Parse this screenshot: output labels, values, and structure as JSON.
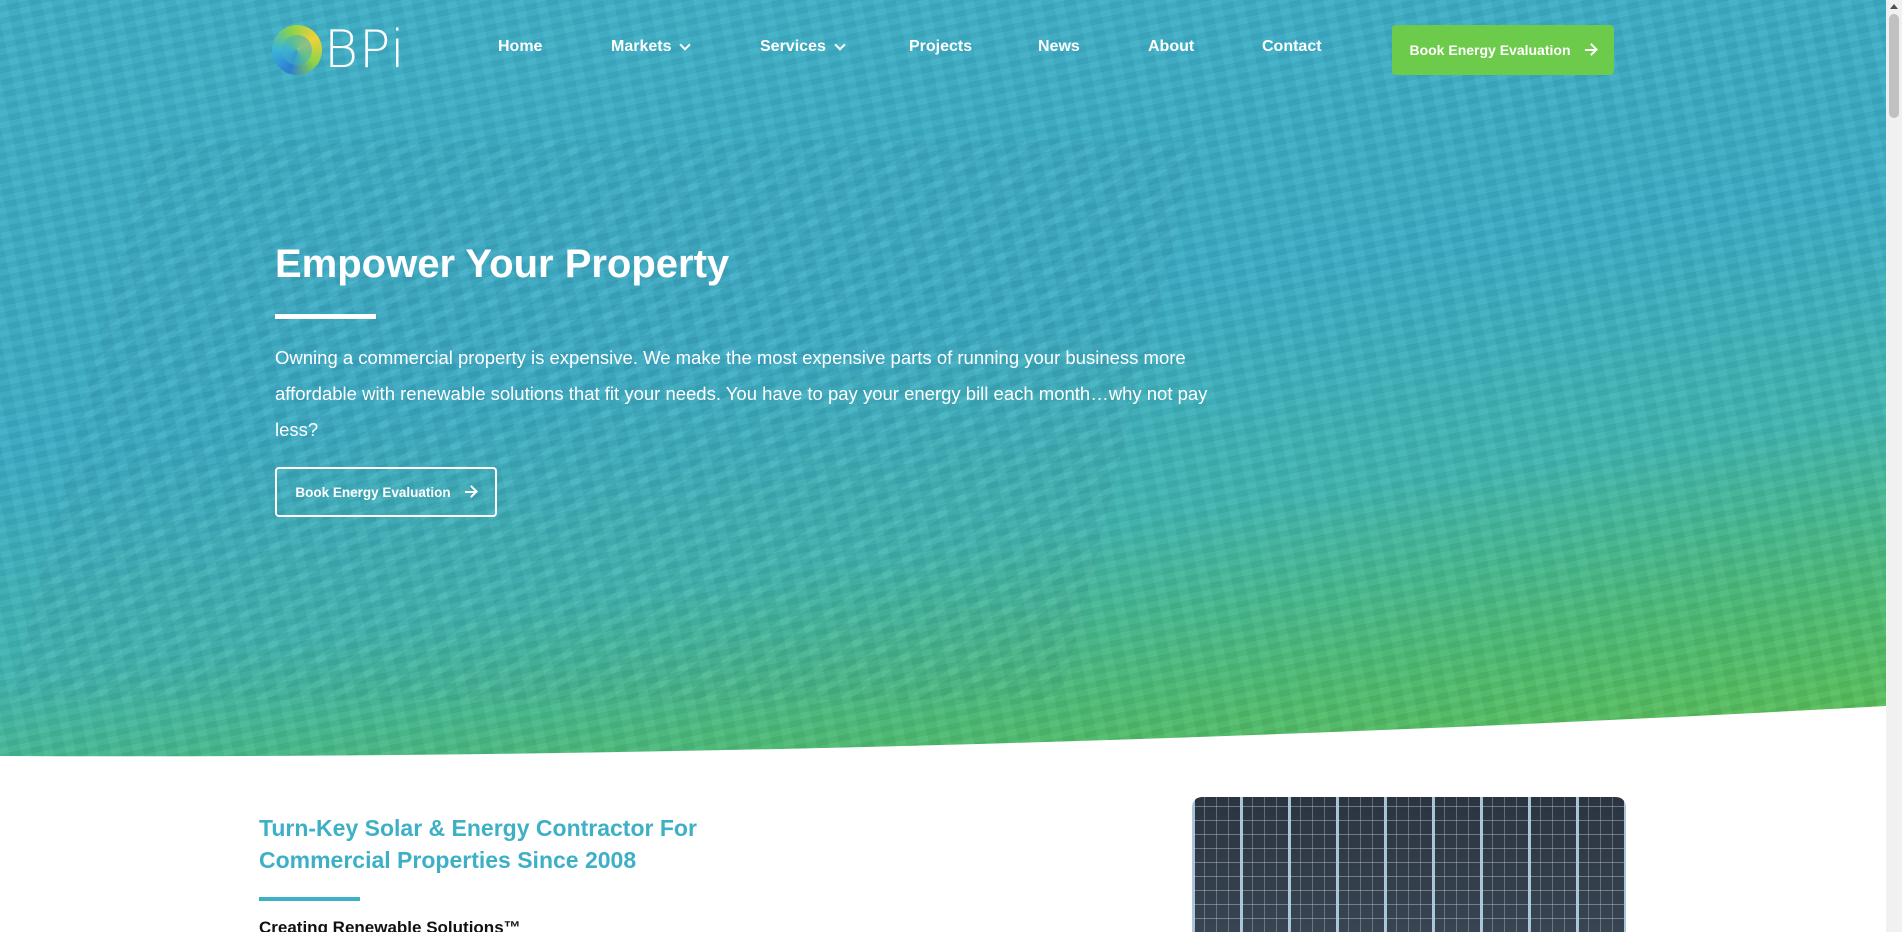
{
  "header": {
    "logo_text": "BPi",
    "nav": [
      {
        "label": "Home",
        "has_dropdown": false
      },
      {
        "label": "Markets",
        "has_dropdown": true
      },
      {
        "label": "Services",
        "has_dropdown": true
      },
      {
        "label": "Projects",
        "has_dropdown": false
      },
      {
        "label": "News",
        "has_dropdown": false
      },
      {
        "label": "About",
        "has_dropdown": false
      },
      {
        "label": "Contact",
        "has_dropdown": false
      }
    ],
    "cta_label": "Book Energy Evaluation",
    "cta_icon": "arrow-right-icon"
  },
  "hero": {
    "title": "Empower Your Property",
    "text": "Owning a commercial property is expensive. We make the most expensive parts of running your business more affordable with renewable solutions that fit your needs. You have to pay your energy bill each month…why not pay less?",
    "cta_label": "Book Energy Evaluation",
    "cta_icon": "arrow-right-icon"
  },
  "section": {
    "title": "Turn-Key Solar & Energy Contractor For Commercial Properties Since 2008",
    "subtitle": "Creating Renewable Solutions™"
  },
  "colors": {
    "accent_teal": "#3eb0c6",
    "accent_green": "#6ccb4a",
    "text_dark": "#111111"
  }
}
